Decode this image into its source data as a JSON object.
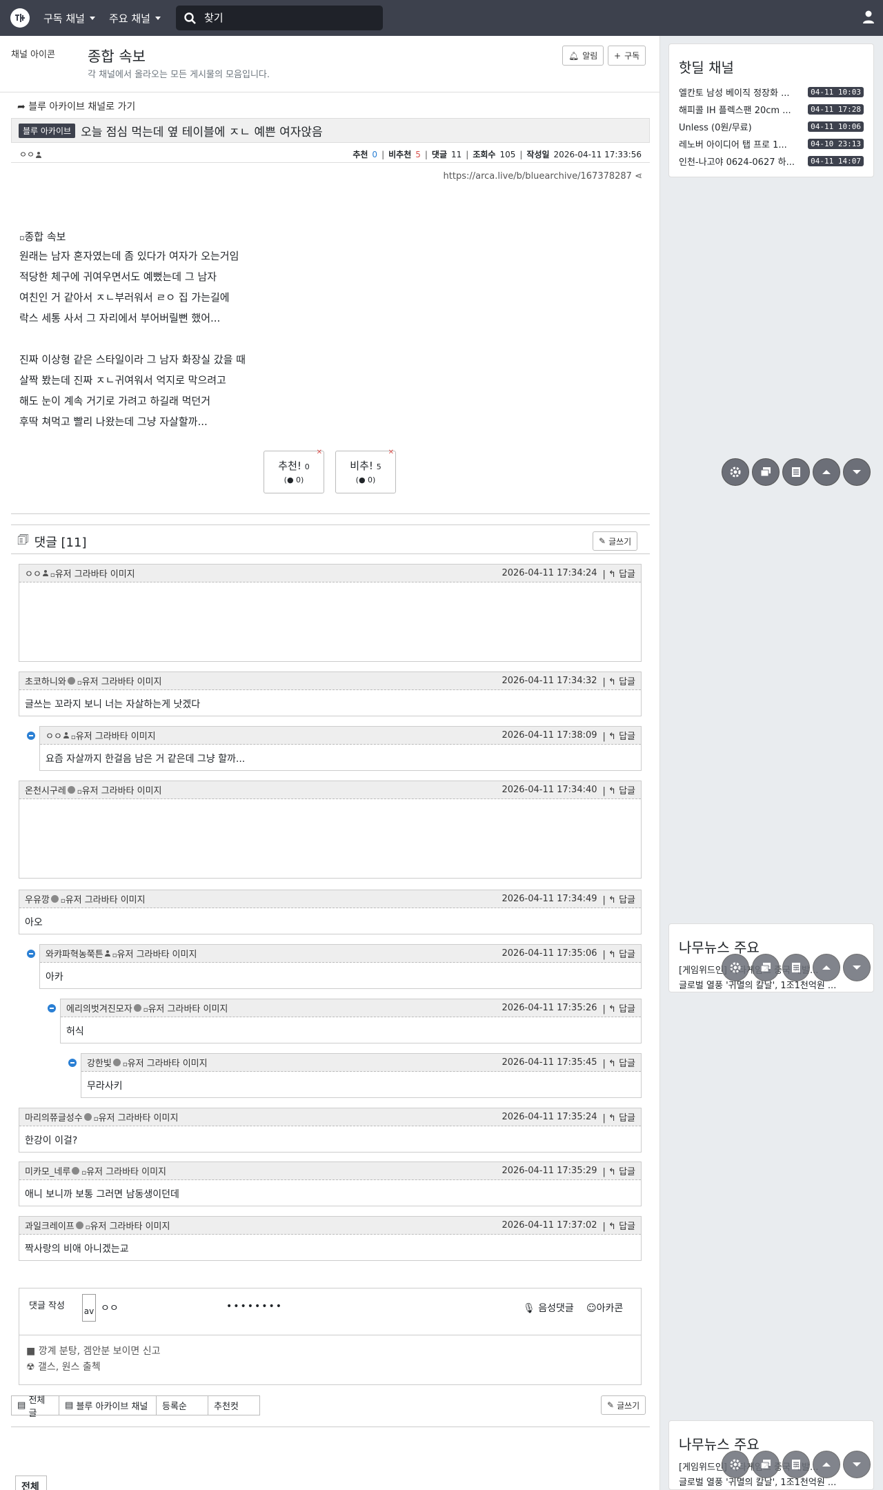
{
  "nav": {
    "menu1": "구독 채널",
    "menu2": "주요 채널",
    "search_placeholder": "찾기"
  },
  "board": {
    "icon_alt": "채널 아이콘",
    "title": "종합 속보",
    "desc": "각 채널에서 올라오는 모든 게시물의 모음입니다.",
    "alarm": "알림",
    "subscribe": "구독"
  },
  "post": {
    "back": "블루 아카이브 채널로 가기",
    "category": "블루 아카이브",
    "title": "오늘 점심 먹는데 옆 테이블에 ㅈㄴ 예쁜 여자앉음",
    "author": "ㅇㅇ",
    "labels": {
      "up": "추천",
      "down": "비추천",
      "comments": "댓글",
      "views": "조회수",
      "date": "작성일"
    },
    "up": "0",
    "down": "5",
    "comments": "11",
    "views": "105",
    "date": "2026-04-11 17:33:56",
    "url": "https://arca.live/b/bluearchive/167378287",
    "image_alt": "종합 속보",
    "lines": [
      "원래는 남자 혼자였는데 좀 있다가 여자가 오는거임",
      "적당한 체구에 귀여우면서도 예뻤는데 그 남자",
      "여친인 거 같아서 ㅈㄴ부러워서 ㄹㅇ 집 가는길에",
      "락스 세통 사서 그 자리에서 부어버릴뻔 했어...",
      "",
      "진짜 이상형 같은 스타일이라 그 남자 화장실 갔을 때",
      "살짝 봤는데 진짜 ㅈㄴ귀여워서 억지로 막으려고",
      "해도 눈이 계속 거기로 가려고 하길래 먹던거",
      "후딱 쳐먹고 빨리 나왔는데 그냥 자살할까..."
    ],
    "vote_up": "추천!",
    "vote_up_n": "0",
    "vote_up_sub": "0",
    "vote_down": "비추!",
    "vote_down_n": "5",
    "vote_down_sub": "0"
  },
  "comments_section": {
    "title": "댓글 [11]",
    "write": "글쓰기",
    "img_alt": "유저 그라바타 이미지",
    "reply": "답글",
    "items": [
      {
        "nick": "ㅇㅇ",
        "time": "2026-04-11 17:34:24",
        "body": ""
      },
      {
        "nick": "초코하니와",
        "time": "2026-04-11 17:34:32",
        "body": "글쓰는 꼬라지 보니 너는 자살하는게 낫겠다"
      },
      {
        "nick": "ㅇㅇ",
        "time": "2026-04-11 17:38:09",
        "body": "요즘 자살까지 한걸음 남은 거 같은데 그냥 할까..."
      },
      {
        "nick": "온천시구레",
        "time": "2026-04-11 17:34:40",
        "body": ""
      },
      {
        "nick": "우유깡",
        "time": "2026-04-11 17:34:49",
        "body": "아오"
      },
      {
        "nick": "와캬파혁농쭉튼",
        "time": "2026-04-11 17:35:06",
        "body": "아카"
      },
      {
        "nick": "에리의벗겨진모자",
        "time": "2026-04-11 17:35:26",
        "body": "허식"
      },
      {
        "nick": "강한빛",
        "time": "2026-04-11 17:35:45",
        "body": "무라사키"
      },
      {
        "nick": "마리의쮸글성수",
        "time": "2026-04-11 17:35:24",
        "body": "한강이 이걸?"
      },
      {
        "nick": "미카모_네루",
        "time": "2026-04-11 17:35:29",
        "body": "애니 보니까 보통 그러면 남동생이던데"
      },
      {
        "nick": "과일크레이프",
        "time": "2026-04-11 17:37:02",
        "body": "짝사랑의 비애 아니겠는교"
      }
    ]
  },
  "write_form": {
    "label": "댓글 작성",
    "avatar_alt": "av",
    "name": "ㅇㅇ",
    "password": "••••••••",
    "voice": "음성댓글",
    "emoji": "아카콘",
    "rule1": "깡계 분탕, 겜안분 보이면 신고",
    "rule2": "갤스, 원스 출첵"
  },
  "filters": [
    "전체글",
    "블루 아카이브 채널",
    "등록순",
    "추천컷"
  ],
  "bottom_write": "글쓰기",
  "all_button": "전체",
  "sidebar": {
    "hot_title": "핫딜 채널",
    "hot": [
      {
        "t": "엘칸토 남성 베이직 정장화 ...",
        "d": "04-11 10:03"
      },
      {
        "t": "해피콜 IH 플렉스팬 20cm ...",
        "d": "04-11 17:28"
      },
      {
        "t": "Unless (0원/무료)",
        "d": "04-11 10:06"
      },
      {
        "t": "레노버 아이디어 탭 프로 1...",
        "d": "04-10 23:13"
      },
      {
        "t": "인천-나고야 0624-0627 하...",
        "d": "04-11 14:07"
      }
    ],
    "news_title": "나무뉴스 주요",
    "news": [
      "[게임위드인] 타타게임즈 중국 개발...",
      "글로벌 열풍 '귀멸의 칼날', 1조1천억원 ..."
    ]
  }
}
